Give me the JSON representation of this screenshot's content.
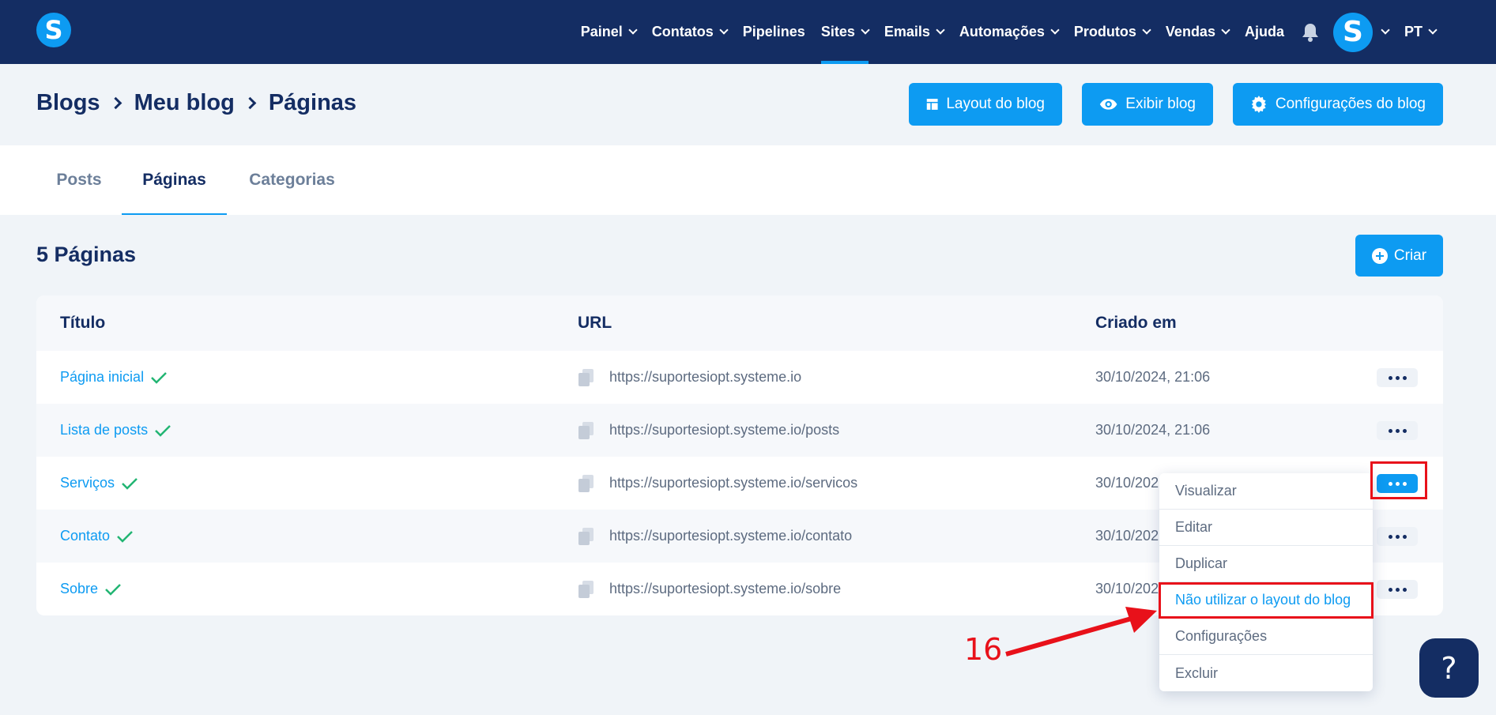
{
  "topbar": {
    "logo_letter": "S",
    "nav": [
      {
        "label": "Painel",
        "chevron": true
      },
      {
        "label": "Contatos",
        "chevron": true
      },
      {
        "label": "Pipelines",
        "chevron": false
      },
      {
        "label": "Sites",
        "chevron": true,
        "active": true
      },
      {
        "label": "Emails",
        "chevron": true
      },
      {
        "label": "Automações",
        "chevron": true
      },
      {
        "label": "Produtos",
        "chevron": true
      },
      {
        "label": "Vendas",
        "chevron": true
      },
      {
        "label": "Ajuda",
        "chevron": false
      }
    ],
    "bell_icon": "bell-icon",
    "avatar_letter": "S",
    "language": "PT"
  },
  "header": {
    "breadcrumb": [
      "Blogs",
      "Meu blog",
      "Páginas"
    ],
    "buttons": {
      "layout": "Layout do blog",
      "view": "Exibir blog",
      "settings": "Configurações do blog"
    }
  },
  "tabs": [
    "Posts",
    "Páginas",
    "Categorias"
  ],
  "section": {
    "title": "5 Páginas",
    "create_label": "Criar"
  },
  "table": {
    "headers": [
      "Título",
      "URL",
      "Criado em"
    ],
    "rows": [
      {
        "title": "Página inicial",
        "url": "https://suportesiopt.systeme.io",
        "created": "30/10/2024, 21:06"
      },
      {
        "title": "Lista de posts",
        "url": "https://suportesiopt.systeme.io/posts",
        "created": "30/10/2024, 21:06"
      },
      {
        "title": "Serviços",
        "url": "https://suportesiopt.systeme.io/servicos",
        "created": "30/10/202"
      },
      {
        "title": "Contato",
        "url": "https://suportesiopt.systeme.io/contato",
        "created": "30/10/202"
      },
      {
        "title": "Sobre",
        "url": "https://suportesiopt.systeme.io/sobre",
        "created": "30/10/202"
      }
    ]
  },
  "dropdown": {
    "items": [
      "Visualizar",
      "Editar",
      "Duplicar",
      "Não utilizar o layout do blog",
      "Configurações",
      "Excluir"
    ],
    "highlighted_index": 3
  },
  "annotation": {
    "number": "16",
    "color": "#e8111a"
  },
  "help": {
    "label": "?"
  },
  "colors": {
    "navy": "#142d63",
    "accent": "#0d9bf2",
    "background": "#f0f4f8",
    "check": "#22b573"
  }
}
